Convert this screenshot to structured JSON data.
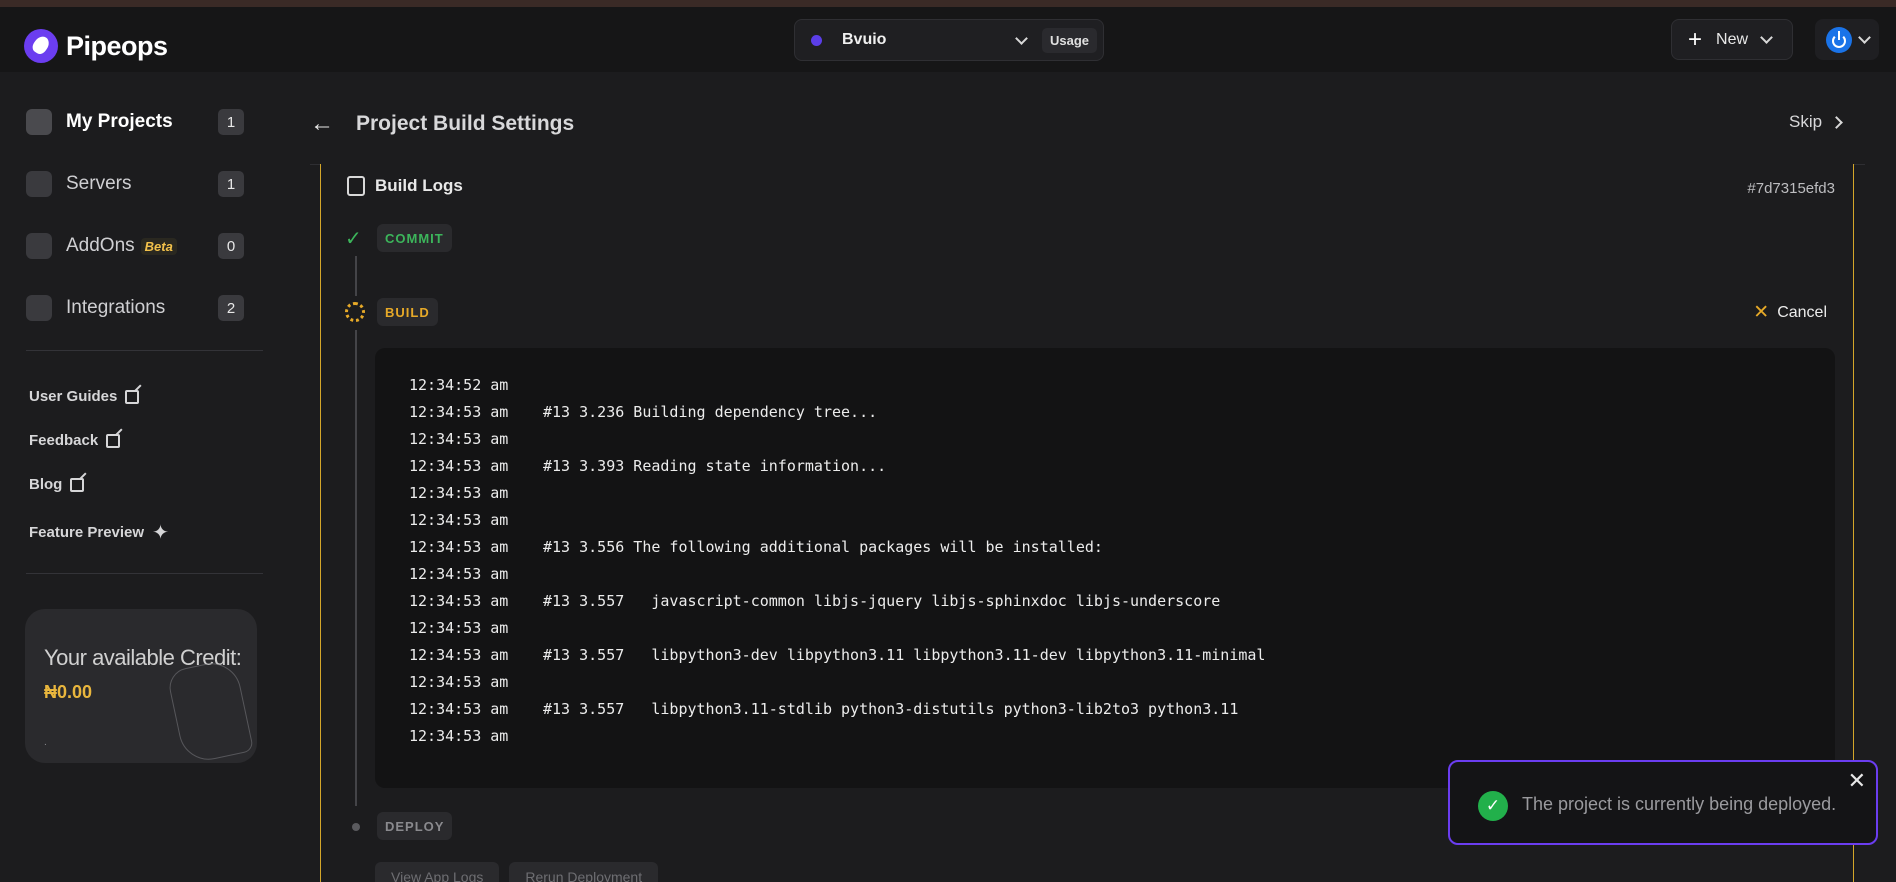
{
  "header": {
    "brand": "Pipeops",
    "project_name": "Bvuio",
    "usage_label": "Usage",
    "new_label": "New"
  },
  "sidebar": {
    "nav": [
      {
        "label": "My Projects",
        "count": "1"
      },
      {
        "label": "Servers",
        "count": "1"
      },
      {
        "label": "AddOns",
        "badge": "Beta",
        "count": "0"
      },
      {
        "label": "Integrations",
        "count": "2"
      }
    ],
    "links": [
      {
        "label": "User Guides"
      },
      {
        "label": "Feedback"
      },
      {
        "label": "Blog"
      },
      {
        "label": "Feature Preview"
      }
    ],
    "credit": {
      "title": "Your available Credit:",
      "amount": "₦0.00",
      "footnote": "."
    }
  },
  "main": {
    "title": "Project Build Settings",
    "skip_label": "Skip",
    "panel_title": "Build Logs",
    "commit_hash": "#7d7315efd3",
    "steps": {
      "commit": "COMMIT",
      "build": "BUILD",
      "deploy": "DEPLOY"
    },
    "cancel_label": "Cancel",
    "logs": [
      {
        "time": "12:34:52 am",
        "msg": ""
      },
      {
        "time": "12:34:53 am",
        "msg": "#13 3.236 Building dependency tree..."
      },
      {
        "time": "12:34:53 am",
        "msg": ""
      },
      {
        "time": "12:34:53 am",
        "msg": "#13 3.393 Reading state information..."
      },
      {
        "time": "12:34:53 am",
        "msg": ""
      },
      {
        "time": "12:34:53 am",
        "msg": ""
      },
      {
        "time": "12:34:53 am",
        "msg": "#13 3.556 The following additional packages will be installed:"
      },
      {
        "time": "12:34:53 am",
        "msg": ""
      },
      {
        "time": "12:34:53 am",
        "msg": "#13 3.557   javascript-common libjs-jquery libjs-sphinxdoc libjs-underscore"
      },
      {
        "time": "12:34:53 am",
        "msg": ""
      },
      {
        "time": "12:34:53 am",
        "msg": "#13 3.557   libpython3-dev libpython3.11 libpython3.11-dev libpython3.11-minimal"
      },
      {
        "time": "12:34:53 am",
        "msg": ""
      },
      {
        "time": "12:34:53 am",
        "msg": "#13 3.557   libpython3.11-stdlib python3-distutils python3-lib2to3 python3.11"
      },
      {
        "time": "12:34:53 am",
        "msg": ""
      }
    ],
    "buttons": {
      "view_logs": "View App Logs",
      "rerun": "Rerun Deployment"
    }
  },
  "toast": {
    "message": "The project is currently being deployed.",
    "close_glyph": "✕",
    "check_glyph": "✓"
  }
}
